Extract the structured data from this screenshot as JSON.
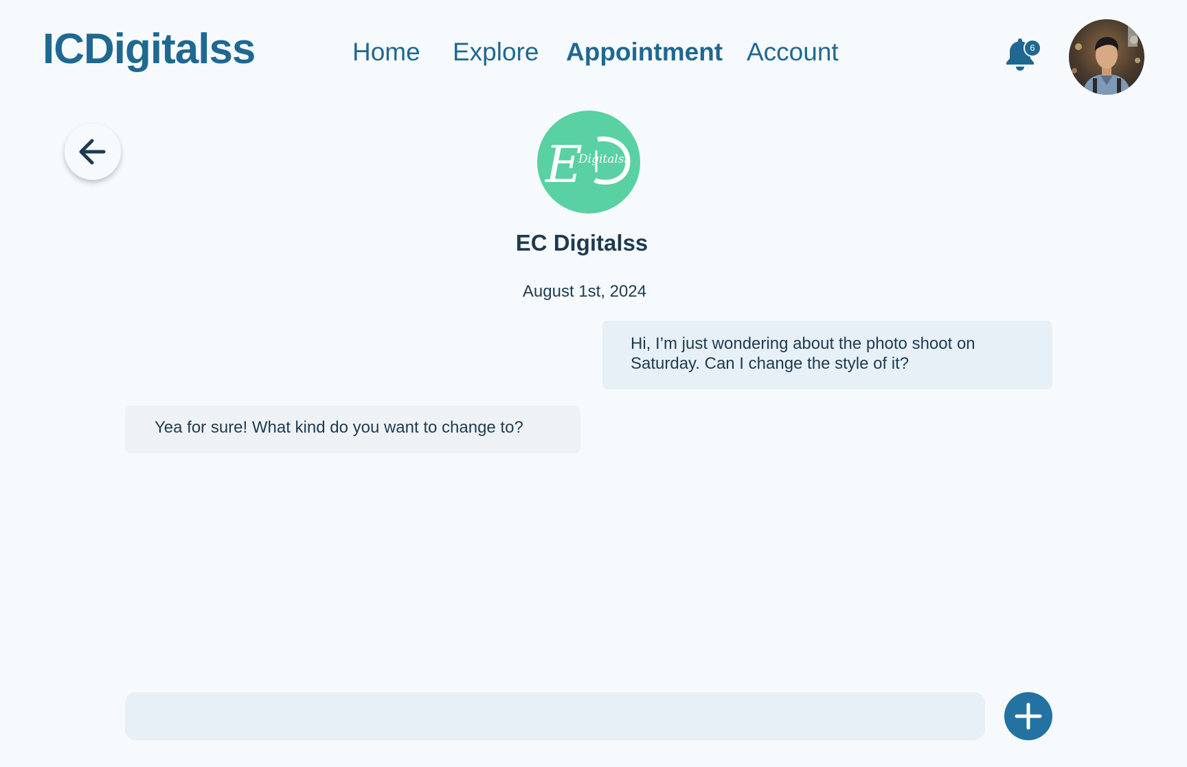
{
  "header": {
    "logo_text": "ICDigitalss",
    "nav": [
      {
        "label": "Home",
        "active": false
      },
      {
        "label": "Explore",
        "active": false
      },
      {
        "label": "Appointment",
        "active": true
      },
      {
        "label": "Account",
        "active": false
      }
    ],
    "notifications_count": "6",
    "bell_icon": "bell-icon",
    "avatar_icon": "user-avatar"
  },
  "conversation": {
    "back_icon": "arrow-left-icon",
    "contact_logo_text": "Digitalss",
    "contact_logo_initials": "E",
    "contact_name": "EC Digitalss",
    "date": "August 1st, 2024",
    "messages": [
      {
        "direction": "outgoing",
        "text": "Hi, I’m just wondering about the photo shoot on Saturday. Can I change the style of it?"
      },
      {
        "direction": "incoming",
        "text": "Yea for sure! What kind do you want to change to?"
      }
    ]
  },
  "composer": {
    "placeholder": "",
    "value": "",
    "add_icon": "plus-icon"
  },
  "colors": {
    "background": "#f6fafd",
    "brand": "#1f6891",
    "text_dark": "#1e3a50",
    "logo_green": "#59d1a2",
    "outgoing_bubble": "#e6f0f6",
    "incoming_bubble": "#eff2f4",
    "add_button": "#2372a1"
  }
}
